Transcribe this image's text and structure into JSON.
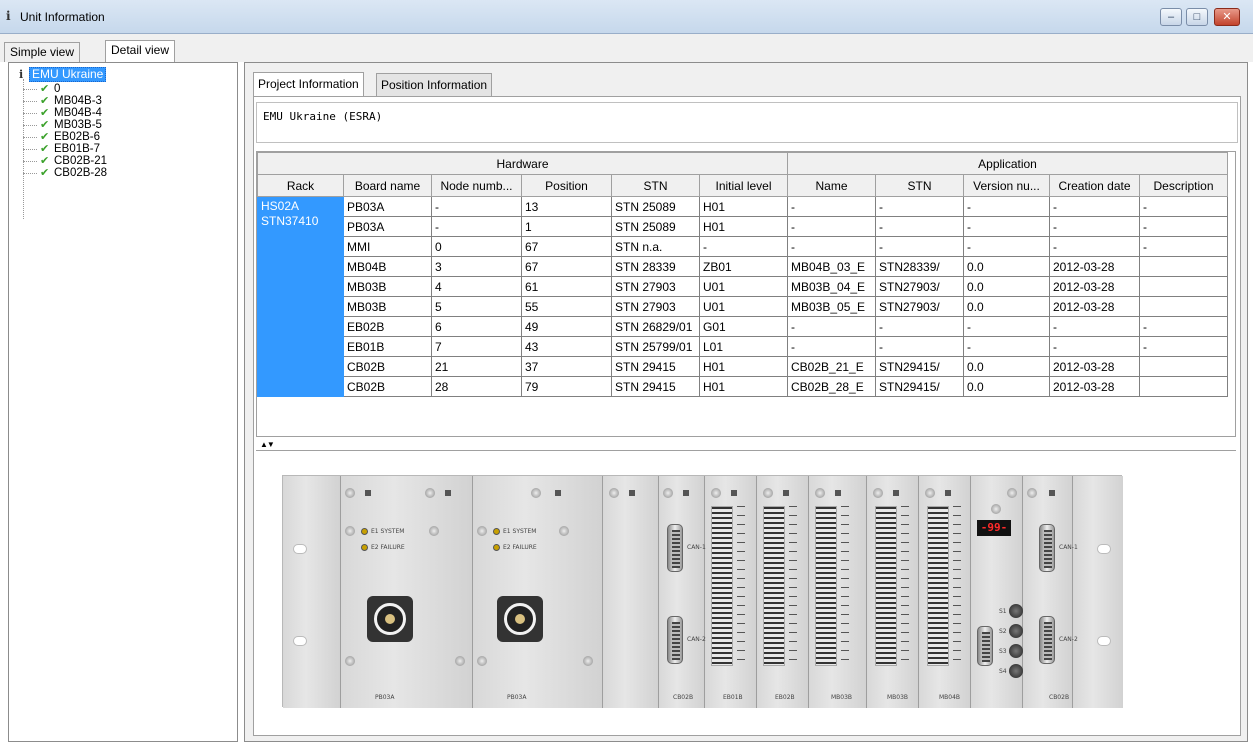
{
  "window": {
    "title": "Unit Information",
    "buttons": [
      "minimize",
      "maximize",
      "close"
    ]
  },
  "outer_tabs": [
    {
      "label": "Simple view",
      "active": false
    },
    {
      "label": "Detail view",
      "active": true
    }
  ],
  "tree": {
    "root": "EMU Ukraine",
    "items": [
      "0",
      "MB04B-3",
      "MB04B-4",
      "MB03B-5",
      "EB02B-6",
      "EB01B-7",
      "CB02B-21",
      "CB02B-28"
    ]
  },
  "inner_tabs": [
    {
      "label": "Project Information",
      "active": true
    },
    {
      "label": "Position Information",
      "active": false
    }
  ],
  "project_text": "EMU Ukraine (ESRA)",
  "table": {
    "groups": [
      {
        "label": "Hardware"
      },
      {
        "label": "Application"
      }
    ],
    "headers": [
      "Rack",
      "Board name",
      "Node numb...",
      "Position",
      "STN",
      "Initial level",
      "Name",
      "STN",
      "Version nu...",
      "Creation date",
      "Description"
    ],
    "rack_lines": [
      "HS02A",
      "STN37410"
    ],
    "rows": [
      [
        "PB03A",
        "-",
        "13",
        "STN 25089",
        "H01",
        "-",
        "-",
        "-",
        "-",
        "-"
      ],
      [
        "PB03A",
        "-",
        "1",
        "STN 25089",
        "H01",
        "-",
        "-",
        "-",
        "-",
        "-"
      ],
      [
        "MMI",
        "0",
        "67",
        "STN n.a.",
        "-",
        "-",
        "-",
        "-",
        "-",
        "-"
      ],
      [
        "MB04B",
        "3",
        "67",
        "STN 28339",
        "ZB01",
        "MB04B_03_E",
        "STN28339/",
        "0.0",
        "2012-03-28",
        ""
      ],
      [
        "MB03B",
        "4",
        "61",
        "STN 27903",
        "U01",
        "MB03B_04_E",
        "STN27903/",
        "0.0",
        "2012-03-28",
        ""
      ],
      [
        "MB03B",
        "5",
        "55",
        "STN 27903",
        "U01",
        "MB03B_05_E",
        "STN27903/",
        "0.0",
        "2012-03-28",
        ""
      ],
      [
        "EB02B",
        "6",
        "49",
        "STN 26829/01",
        "G01",
        "-",
        "-",
        "-",
        "-",
        "-"
      ],
      [
        "EB01B",
        "7",
        "43",
        "STN 25799/01",
        "L01",
        "-",
        "-",
        "-",
        "-",
        "-"
      ],
      [
        "CB02B",
        "21",
        "37",
        "STN 29415",
        "H01",
        "CB02B_21_E",
        "STN29415/",
        "0.0",
        "2012-03-28",
        ""
      ],
      [
        "CB02B",
        "28",
        "79",
        "STN 29415",
        "H01",
        "CB02B_28_E",
        "STN29415/",
        "0.0",
        "2012-03-28",
        ""
      ]
    ]
  },
  "rack_image": {
    "display": "-99-",
    "bottom_labels": [
      "PB03A",
      "PB03A",
      "CB02B",
      "EB01B",
      "EB02B",
      "MB03B",
      "MB03B",
      "MB04B",
      "CB02B"
    ],
    "panel_text": [
      "E1 SYSTEM",
      "E2 FAILURE"
    ],
    "can_labels": [
      "CAN-1",
      "CAN-2"
    ],
    "switch_labels": [
      "S1",
      "S2",
      "S3",
      "S4"
    ]
  }
}
